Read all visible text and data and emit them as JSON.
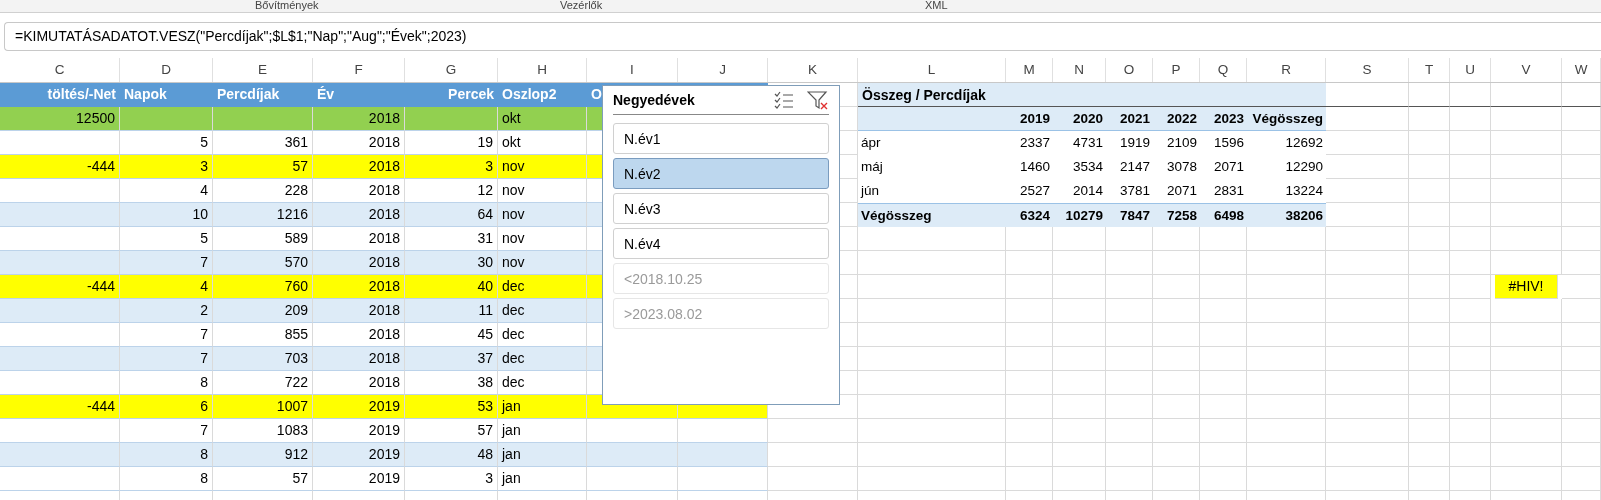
{
  "ribbon_groups": [
    "Bővítmények",
    "Vezérlők",
    "XML"
  ],
  "formula_bar": {
    "value": "=KIMUTATÁSADATOT.VESZ(\"Percdíjak\";$L$1;\"Nap\";\"Aug\";\"Évek\";2023)"
  },
  "column_headers": [
    "C",
    "D",
    "E",
    "F",
    "G",
    "H",
    "I",
    "J",
    "K",
    "L",
    "M",
    "N",
    "O",
    "P",
    "Q",
    "R",
    "S",
    "T",
    "U",
    "V",
    "W"
  ],
  "table": {
    "columns": [
      "töltés/-Net",
      "Napok",
      "Percdíjak",
      "Év",
      "Percek",
      "Oszlop2",
      "O"
    ],
    "rows": [
      {
        "kind": "green",
        "cells": {
          "C": "12500",
          "F": "2018",
          "H": "okt"
        }
      },
      {
        "kind": "plain",
        "cells": {
          "D": "5",
          "E": "361",
          "F": "2018",
          "G": "19",
          "H": "okt"
        }
      },
      {
        "kind": "yellow",
        "cells": {
          "C": "-444",
          "D": "3",
          "E": "57",
          "F": "2018",
          "G": "3",
          "H": "nov"
        }
      },
      {
        "kind": "plain",
        "cells": {
          "D": "4",
          "E": "228",
          "F": "2018",
          "G": "12",
          "H": "nov"
        }
      },
      {
        "kind": "band",
        "cells": {
          "D": "10",
          "E": "1216",
          "F": "2018",
          "G": "64",
          "H": "nov"
        }
      },
      {
        "kind": "plain",
        "cells": {
          "D": "5",
          "E": "589",
          "F": "2018",
          "G": "31",
          "H": "nov"
        }
      },
      {
        "kind": "band",
        "cells": {
          "D": "7",
          "E": "570",
          "F": "2018",
          "G": "30",
          "H": "nov"
        }
      },
      {
        "kind": "yellow",
        "cells": {
          "C": "-444",
          "D": "4",
          "E": "760",
          "F": "2018",
          "G": "40",
          "H": "dec"
        }
      },
      {
        "kind": "band",
        "cells": {
          "D": "2",
          "E": "209",
          "F": "2018",
          "G": "11",
          "H": "dec"
        }
      },
      {
        "kind": "plain",
        "cells": {
          "D": "7",
          "E": "855",
          "F": "2018",
          "G": "45",
          "H": "dec"
        }
      },
      {
        "kind": "band",
        "cells": {
          "D": "7",
          "E": "703",
          "F": "2018",
          "G": "37",
          "H": "dec"
        }
      },
      {
        "kind": "plain",
        "cells": {
          "D": "8",
          "E": "722",
          "F": "2018",
          "G": "38",
          "H": "dec"
        }
      },
      {
        "kind": "yellow",
        "cells": {
          "C": "-444",
          "D": "6",
          "E": "1007",
          "F": "2019",
          "G": "53",
          "H": "jan"
        }
      },
      {
        "kind": "plain",
        "cells": {
          "D": "7",
          "E": "1083",
          "F": "2019",
          "G": "57",
          "H": "jan"
        }
      },
      {
        "kind": "band",
        "cells": {
          "D": "8",
          "E": "912",
          "F": "2019",
          "G": "48",
          "H": "jan"
        }
      },
      {
        "kind": "plain",
        "cells": {
          "D": "8",
          "E": "57",
          "F": "2019",
          "G": "3",
          "H": "jan"
        }
      }
    ]
  },
  "slicer": {
    "title": "Negyedévek",
    "items": [
      {
        "label": "N.év1",
        "selected": false,
        "disabled": false
      },
      {
        "label": "N.év2",
        "selected": true,
        "disabled": false
      },
      {
        "label": "N.év3",
        "selected": false,
        "disabled": false
      },
      {
        "label": "N.év4",
        "selected": false,
        "disabled": false
      },
      {
        "label": "<2018.10.25",
        "selected": false,
        "disabled": true
      },
      {
        "label": ">2023.08.02",
        "selected": false,
        "disabled": true
      }
    ]
  },
  "pivot": {
    "title": "Összeg / Percdíjak",
    "columns": [
      "2019",
      "2020",
      "2021",
      "2022",
      "2023",
      "Végösszeg"
    ],
    "rows": [
      {
        "label": "ápr",
        "values": [
          "2337",
          "4731",
          "1919",
          "2109",
          "1596",
          "12692"
        ]
      },
      {
        "label": "máj",
        "values": [
          "1460",
          "3534",
          "2147",
          "3078",
          "2071",
          "12290"
        ]
      },
      {
        "label": "jún",
        "values": [
          "2527",
          "2014",
          "3781",
          "2071",
          "2831",
          "13224"
        ]
      }
    ],
    "total": {
      "label": "Végösszeg",
      "values": [
        "6324",
        "10279",
        "7847",
        "7258",
        "6498",
        "38206"
      ]
    }
  },
  "error_cell": {
    "value": "#HIV!"
  }
}
